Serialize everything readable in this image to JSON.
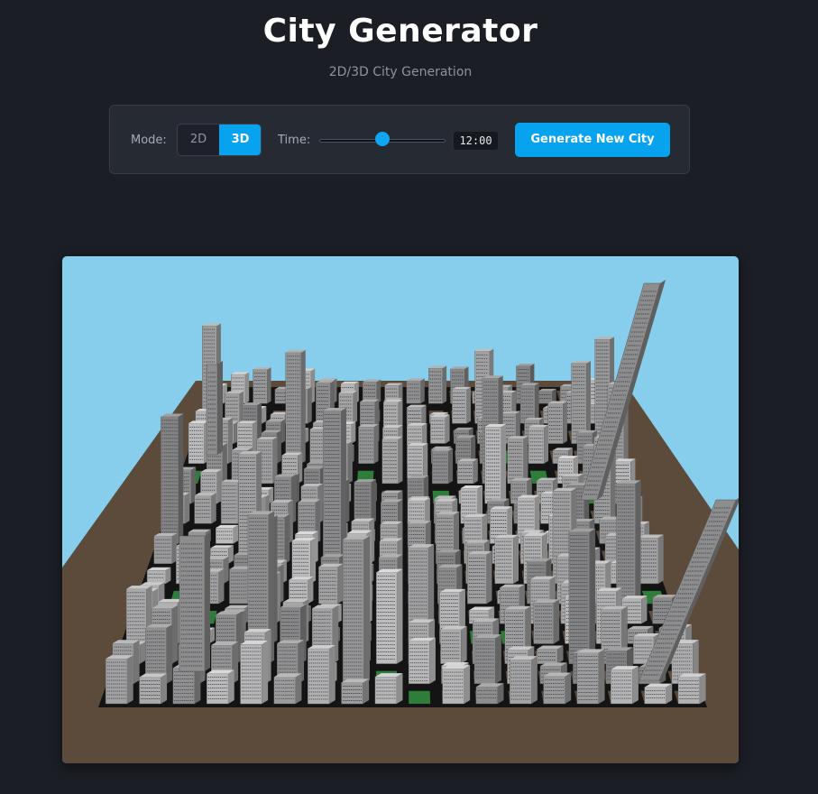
{
  "header": {
    "title": "City Generator",
    "subtitle": "2D/3D City Generation"
  },
  "controls": {
    "mode_label": "Mode:",
    "modes": [
      "2D",
      "3D"
    ],
    "active_mode": "3D",
    "time_label": "Time:",
    "time_value": "12:00",
    "time_slider_fraction": 0.5,
    "generate_button": "Generate New City"
  },
  "scene": {
    "sky_color": "#86ceeb",
    "ground_color": "#5c4a3b",
    "road_color": "#141414",
    "building_color": "#9a9a9a",
    "park_color": "#2e7d3a"
  },
  "colors": {
    "accent": "#08a3ee",
    "background": "#1b1e25",
    "panel": "#262a33"
  }
}
